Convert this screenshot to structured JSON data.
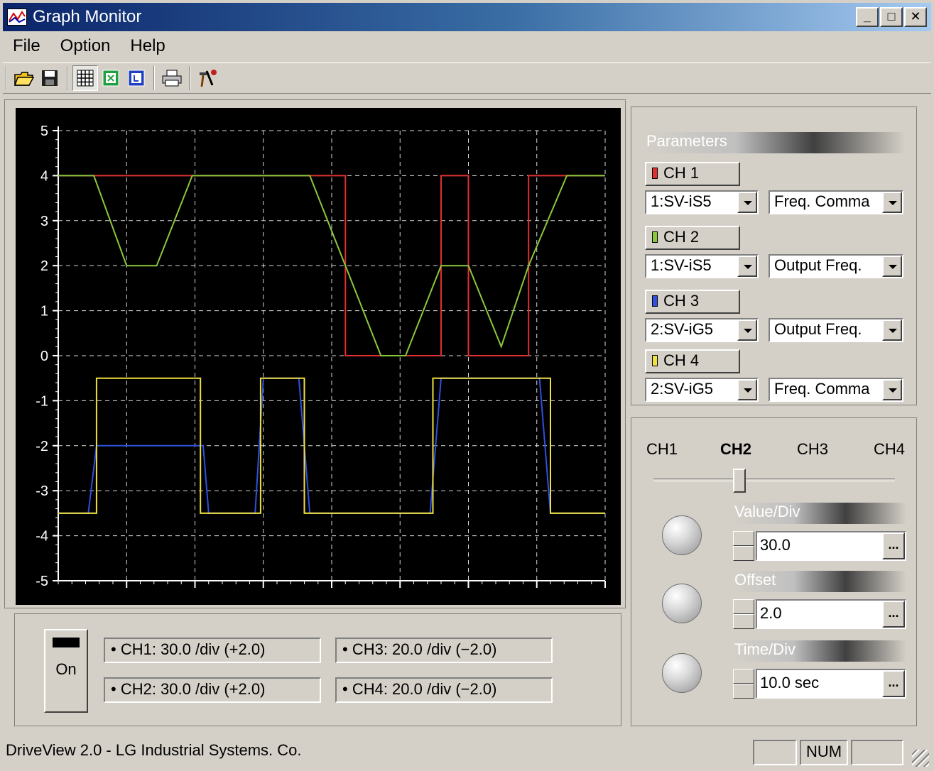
{
  "window": {
    "title": "Graph Monitor",
    "minimize": "_",
    "maximize": "□",
    "close": "✕"
  },
  "menu": {
    "file": "File",
    "option": "Option",
    "help": "Help"
  },
  "plot": {
    "y_ticks": [
      "5",
      "4",
      "3",
      "2",
      "1",
      "0",
      "-1",
      "-2",
      "-3",
      "-4",
      "-5"
    ],
    "background": "#000000",
    "grid_color": "#ffffff",
    "series_colors": {
      "ch1": "#e03030",
      "ch2": "#8cc83c",
      "ch3": "#3050e0",
      "ch4": "#f0e040"
    }
  },
  "chart_data": {
    "type": "line",
    "ylim": [
      -5,
      5
    ],
    "xlim": [
      0,
      100
    ],
    "series": [
      {
        "values": [
          [
            0,
            4
          ],
          [
            52.5,
            4
          ],
          [
            52.5,
            0
          ],
          [
            70,
            0
          ],
          [
            70,
            4
          ],
          [
            75,
            4
          ],
          [
            75,
            0
          ],
          [
            86,
            0
          ],
          [
            86,
            4
          ],
          [
            100,
            4
          ]
        ]
      },
      {
        "values": [
          [
            0,
            4
          ],
          [
            6.5,
            4
          ],
          [
            12.5,
            2
          ],
          [
            18,
            2
          ],
          [
            24.5,
            4
          ],
          [
            46,
            4
          ],
          [
            52.5,
            2
          ],
          [
            59,
            0
          ],
          [
            63.5,
            0
          ],
          [
            70,
            2
          ],
          [
            75,
            2
          ],
          [
            81,
            0.2
          ],
          [
            86,
            2
          ],
          [
            93,
            4
          ],
          [
            100,
            4
          ]
        ]
      },
      {
        "values": [
          [
            0,
            -3.5
          ],
          [
            5.5,
            -3.5
          ],
          [
            7,
            -2
          ],
          [
            26.5,
            -2
          ],
          [
            27.5,
            -3.5
          ],
          [
            36,
            -3.5
          ],
          [
            37.5,
            -0.5
          ],
          [
            44,
            -0.5
          ],
          [
            46,
            -3.5
          ],
          [
            68,
            -3.5
          ],
          [
            70,
            -0.5
          ],
          [
            88,
            -0.5
          ],
          [
            90,
            -3.5
          ],
          [
            100,
            -3.5
          ]
        ]
      },
      {
        "values": [
          [
            0,
            -3.5
          ],
          [
            7,
            -3.5
          ],
          [
            7,
            -0.5
          ],
          [
            26,
            -0.5
          ],
          [
            26,
            -3.5
          ],
          [
            37,
            -3.5
          ],
          [
            37,
            -0.5
          ],
          [
            45,
            -0.5
          ],
          [
            45,
            -3.5
          ],
          [
            68.5,
            -3.5
          ],
          [
            68.5,
            -0.5
          ],
          [
            90,
            -0.5
          ],
          [
            90,
            -3.5
          ],
          [
            100,
            -3.5
          ]
        ]
      }
    ]
  },
  "info": {
    "on_label": "On",
    "ch1": "• CH1:  30.0 /div (+2.0)",
    "ch2": "• CH2:  30.0 /div (+2.0)",
    "ch3": "• CH3:  20.0 /div (−2.0)",
    "ch4": "• CH4:  20.0 /div (−2.0)"
  },
  "params": {
    "header": "Parameters",
    "channels": [
      {
        "label": "CH 1",
        "color": "#e03030",
        "device": "1:SV-iS5",
        "param": "Freq. Comma"
      },
      {
        "label": "CH 2",
        "color": "#8cc83c",
        "device": "1:SV-iS5",
        "param": "Output Freq."
      },
      {
        "label": "CH 3",
        "color": "#3050e0",
        "device": "2:SV-iG5",
        "param": "Output Freq."
      },
      {
        "label": "CH 4",
        "color": "#f0e040",
        "device": "2:SV-iG5",
        "param": "Freq. Comma"
      }
    ]
  },
  "controls": {
    "selector": [
      "CH1",
      "CH2",
      "CH3",
      "CH4"
    ],
    "selected": "CH2",
    "value_div_label": "Value/Div",
    "value_div": "30.0",
    "offset_label": "Offset",
    "offset": "2.0",
    "time_div_label": "Time/Div",
    "time_div": "10.0 sec",
    "browse": "..."
  },
  "status": {
    "text": "DriveView 2.0 - LG Industrial Systems. Co.",
    "num": "NUM"
  }
}
